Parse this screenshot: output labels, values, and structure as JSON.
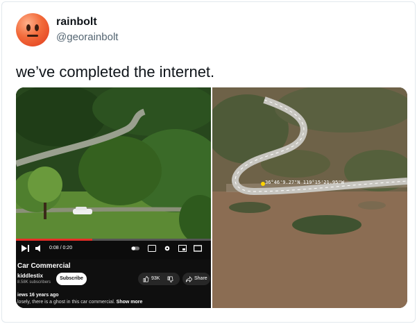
{
  "author": {
    "name": "rainbolt",
    "handle": "@georainbolt"
  },
  "tweet": {
    "text": "we’ve completed the internet."
  },
  "video": {
    "time": "0:08 / 0:20",
    "progress_fraction": 0.39,
    "title": "Car Commercial",
    "channel": "kiddlestix",
    "subscribers": "8.58K subscribers",
    "subscribe_label": "Subscribe",
    "likes": "93K",
    "share_label": "Share",
    "views": "iews  16 years ago",
    "description": "losely, there is a ghost in this car commercial.",
    "show_more": "Show more"
  },
  "map": {
    "coordinates": "36°46'9.27\"N  119°15'21.95\"W"
  },
  "colors": {
    "youtube_red": "#e52d27",
    "pin_yellow": "#ffd400"
  }
}
